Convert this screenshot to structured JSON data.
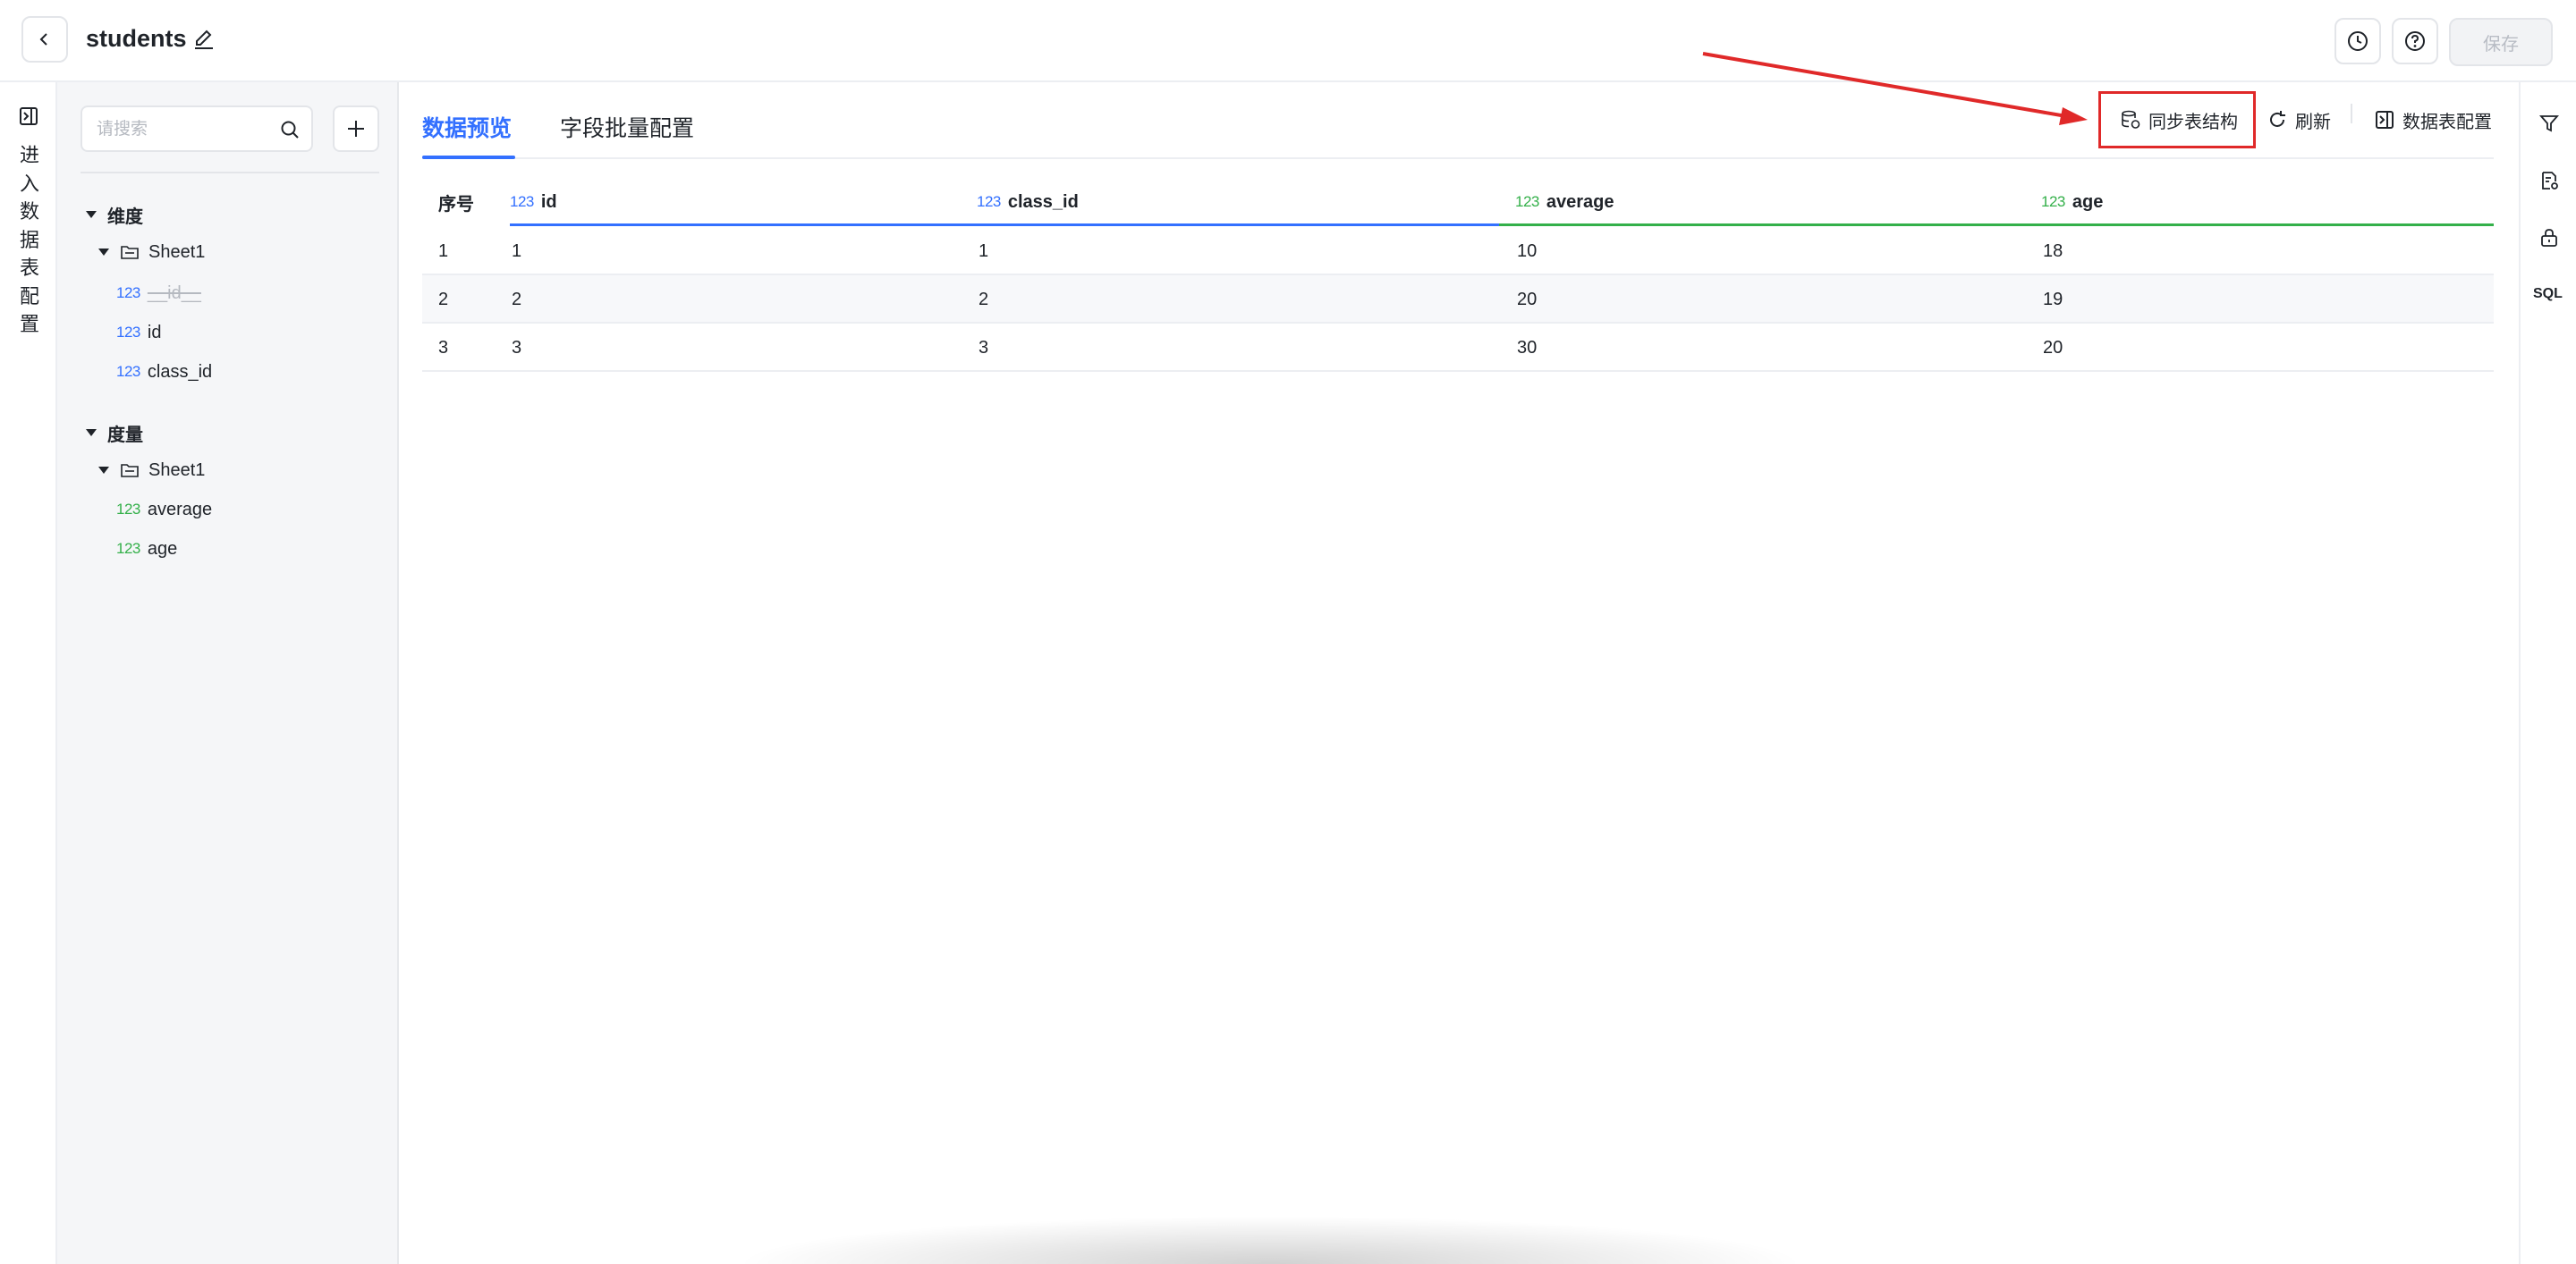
{
  "header": {
    "title": "students",
    "save_label": "保存",
    "icons": [
      "history-icon",
      "help-icon"
    ]
  },
  "left_rail": {
    "label": "进入数据表配置"
  },
  "field_panel": {
    "search_placeholder": "请搜索",
    "dimension_group": "维度",
    "measure_group": "度量",
    "dimension_folder": "Sheet1",
    "measure_folder": "Sheet1",
    "badge": "123",
    "dimension_fields": [
      "__id__",
      "id",
      "class_id"
    ],
    "measure_fields": [
      "average",
      "age"
    ]
  },
  "tabs": [
    "数据预览",
    "字段批量配置"
  ],
  "toolbar": {
    "sync_label": "同步表结构",
    "refresh_label": "刷新",
    "config_label": "数据表配置"
  },
  "table": {
    "index_header": "序号",
    "badge": "123",
    "columns": [
      "id",
      "class_id",
      "average",
      "age"
    ],
    "rows": [
      [
        "1",
        "1",
        "1",
        "10",
        "18"
      ],
      [
        "2",
        "2",
        "2",
        "20",
        "19"
      ],
      [
        "3",
        "3",
        "3",
        "30",
        "20"
      ]
    ]
  },
  "right_rail": {
    "sql_label": "SQL"
  },
  "colors": {
    "accent": "#3370ff",
    "measure": "#34b04a",
    "annotation": "#e02929"
  }
}
